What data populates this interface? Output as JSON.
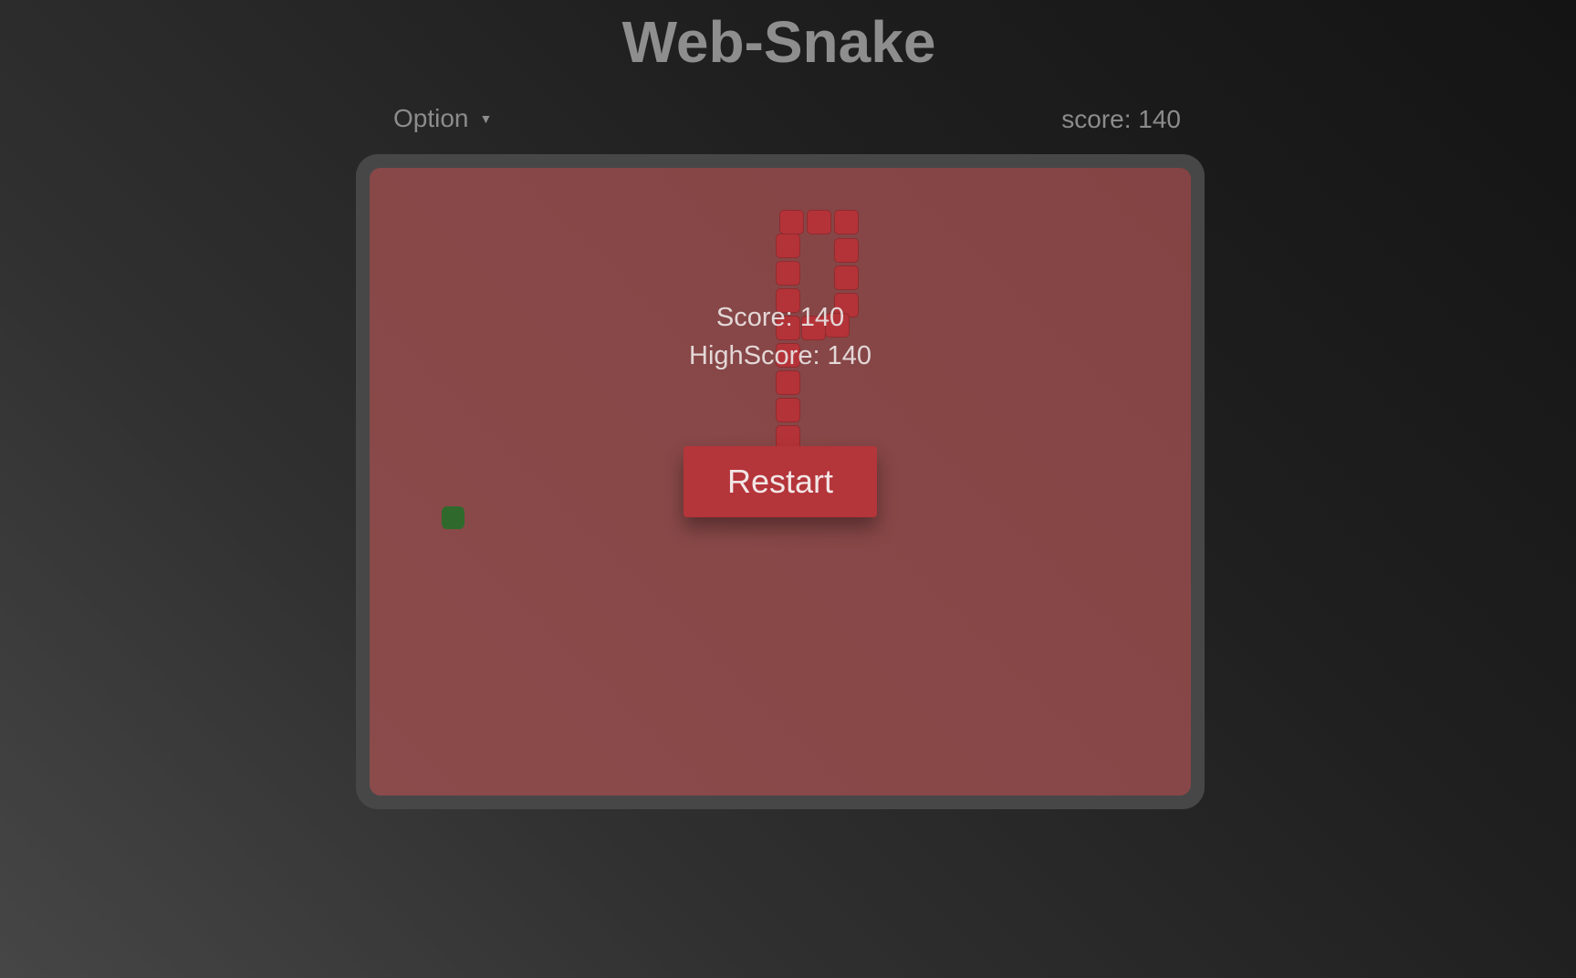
{
  "header": {
    "title": "Web-Snake"
  },
  "toolbar": {
    "option_label": "Option",
    "option_caret_icon": "caret-down-icon",
    "score_label": "score: 140"
  },
  "game": {
    "score_text": "Score: 140",
    "highscore_text": "HighScore: 140",
    "restart_label": "Restart",
    "score": 140,
    "highscore": 140,
    "colors": {
      "board": "#874747",
      "snake": "#b43338",
      "food": "#2f6a2c",
      "frame": "#474747"
    }
  }
}
